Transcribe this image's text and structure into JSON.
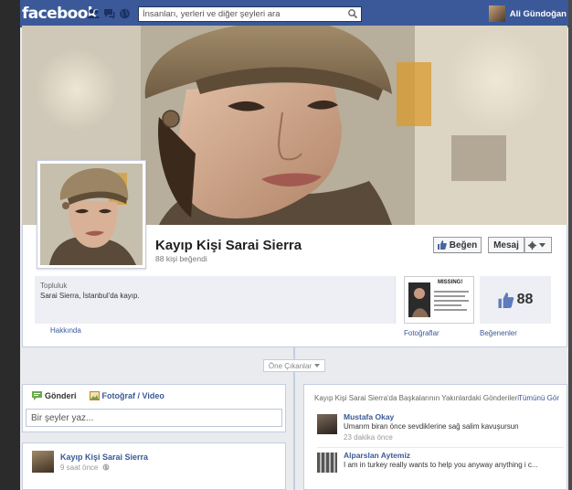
{
  "topbar": {
    "logo": "facebook",
    "search_placeholder": "İnsanları, yerleri ve diğer şeyleri ara",
    "user_name": "Ali Gündoğan",
    "bg_color": "#3b5998"
  },
  "page": {
    "name": "Kayıp Kişi Sarai Sierra",
    "likes_line": "88 kişi beğendi",
    "like_button": "Beğen",
    "message_button": "Mesaj",
    "category": "Topluluk",
    "about": "Sarai Sierra, İstanbul'da kayıp.",
    "about_link": "Hakkında",
    "photos_link": "Fotoğraflar",
    "likes_count": "88",
    "likes_link": "Beğenenler",
    "missing_poster_text": "MISSING!"
  },
  "timeline": {
    "highlights_label": "Öne Çıkanlar",
    "composer": {
      "tab_post": "Gönderi",
      "tab_photo": "Fotoğraf / Video",
      "placeholder": "Bir şeyler yaz..."
    },
    "post": {
      "author": "Kayıp Kişi Sarai Sierra",
      "time": "9 saat önce"
    },
    "recent": {
      "title": "Kayıp Kişi Sarai Sierra'da Başkalarının Yakınlardaki Gönderileri",
      "see_all": "Tümünü Gör",
      "items": [
        {
          "name": "Mustafa Okay",
          "text": "Umarım biran önce sevdiklerine sağ salim kavuşursun",
          "time": "23 dakika önce"
        },
        {
          "name": "Alparslan Aytemiz",
          "text": "I am in turkey really wants to help you anyway anything i c...",
          "time": ""
        }
      ]
    }
  }
}
